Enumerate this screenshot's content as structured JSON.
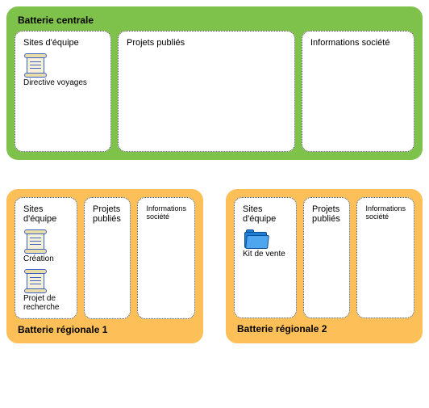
{
  "central": {
    "title": "Batterie centrale",
    "boxes": [
      {
        "title": "Sites d'équipe",
        "items": [
          {
            "icon": "scroll",
            "label": "Directive voyages"
          }
        ]
      },
      {
        "title": "Projets publiés",
        "items": []
      },
      {
        "title": "Informations société",
        "items": []
      }
    ]
  },
  "regional1": {
    "title": "Batterie régionale 1",
    "boxes": [
      {
        "title": "Sites d'équipe",
        "items": [
          {
            "icon": "scroll",
            "label": "Création"
          },
          {
            "icon": "scroll",
            "label": "Projet de recherche"
          }
        ]
      },
      {
        "title": "Projets publiés",
        "items": []
      },
      {
        "title": "Informations société",
        "items": []
      }
    ]
  },
  "regional2": {
    "title": "Batterie régionale 2",
    "boxes": [
      {
        "title": "Sites d'équipe",
        "items": [
          {
            "icon": "folder",
            "label": "Kit de vente"
          }
        ]
      },
      {
        "title": "Projets publiés",
        "items": []
      },
      {
        "title": "Informations société",
        "items": []
      }
    ]
  }
}
